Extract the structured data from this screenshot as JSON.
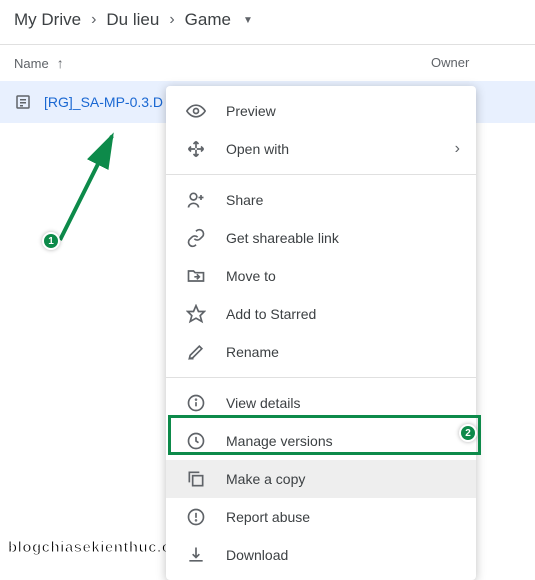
{
  "breadcrumb": {
    "items": [
      "My Drive",
      "Du lieu",
      "Game"
    ]
  },
  "columns": {
    "name": "Name",
    "owner": "Owner"
  },
  "file": {
    "name": "[RG]_SA-MP-0.3.D"
  },
  "menu": {
    "preview": "Preview",
    "open_with": "Open with",
    "share": "Share",
    "get_link": "Get shareable link",
    "move_to": "Move to",
    "starred": "Add to Starred",
    "rename": "Rename",
    "view_details": "View details",
    "manage_versions": "Manage versions",
    "make_copy": "Make a copy",
    "report_abuse": "Report abuse",
    "download": "Download"
  },
  "annotations": {
    "badge1": "1",
    "badge2": "2"
  },
  "watermark": "blogchiasekienthuc.com"
}
